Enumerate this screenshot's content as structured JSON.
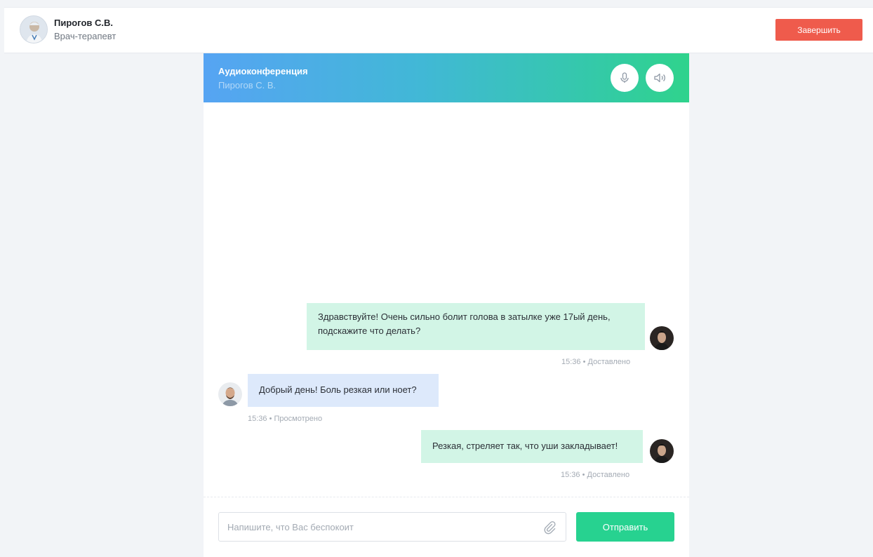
{
  "header": {
    "doctor_name": "Пирогов С.В.",
    "doctor_role": "Врач-терапевт",
    "end_button": "Завершить"
  },
  "conference": {
    "title": "Аудиоконференция",
    "subtitle": "Пирогов С. В.",
    "icons": [
      "microphone-icon",
      "speaker-icon"
    ]
  },
  "messages": [
    {
      "side": "out",
      "text_line1": "Здравствуйте! Очень сильно болит голова в затылке уже 17ый день,",
      "text_line2": "подскажите что делать?",
      "time": "15:36",
      "status": "Доставлено"
    },
    {
      "side": "in",
      "text": "Добрый день! Боль резкая или ноет?",
      "time": "15:36",
      "status": "Просмотрено"
    },
    {
      "side": "out",
      "text": "Резкая, стреляет так, что уши закладывает!",
      "time": "15:36",
      "status": "Доставлено"
    }
  ],
  "composer": {
    "placeholder": "Напишите, что Вас беспокоит",
    "send_label": "Отправить"
  },
  "colors": {
    "accent_green": "#27d290",
    "danger": "#ef5b4c",
    "outgoing_bubble": "#d2f5e6",
    "incoming_bubble": "#dde9fb"
  }
}
